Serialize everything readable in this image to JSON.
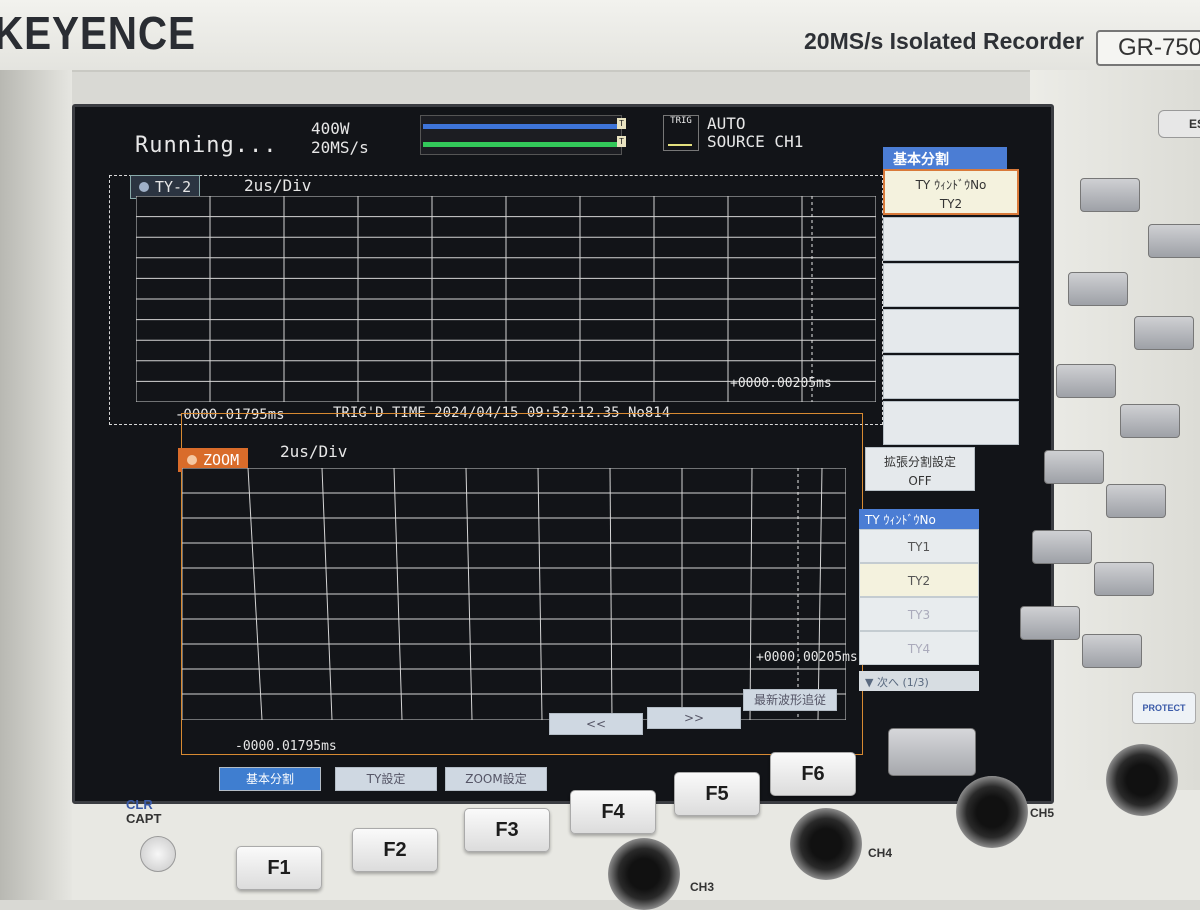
{
  "device": {
    "brand": "KEYENCE",
    "model_text": "20MS/s Isolated Recorder",
    "model_box": "GR-750"
  },
  "header": {
    "status": "Running...",
    "power": "400W",
    "rate": "20MS/s",
    "trig_icon_label": "TRIG",
    "trig_mode": "AUTO",
    "trig_source": "SOURCE CH1"
  },
  "top_pane": {
    "name": "TY-2",
    "div": "2us/Div",
    "left_time": "-0000.01795ms",
    "right_time": "+0000.00205ms",
    "trig_time": "TRIG'D TIME 2024/04/15 09:52:12.35  No814"
  },
  "zoom_pane": {
    "name": "ZOOM",
    "div": "2us/Div",
    "left_time": "-0000.01795ms",
    "right_time": "+0000.00205ms"
  },
  "side_menu": {
    "title": "基本分割",
    "selected_line1": "TY ｳｨﾝﾄﾞｳNo",
    "selected_line2": "TY2",
    "ext_line1": "拡張分割設定",
    "ext_line2": "OFF"
  },
  "sub_menu": {
    "title": "TY ｳｨﾝﾄﾞｳNo",
    "items": [
      "TY1",
      "TY2",
      "TY3",
      "TY4"
    ],
    "nav": "▼ 次へ (1/3)"
  },
  "soft_keys": {
    "f1": "基本分割",
    "f2": "TY設定",
    "f3": "ZOOM設定",
    "f4": "<<",
    "f5": ">>",
    "f6": "最新波形追従"
  },
  "keys": {
    "f1": "F1",
    "f2": "F2",
    "f3": "F3",
    "f4": "F4",
    "f5": "F5",
    "f6": "F6",
    "clr": "CLR",
    "capt": "CAPT",
    "protect": "PROTECT",
    "esc": "ES",
    "ch3": "CH3",
    "ch4": "CH4",
    "ch5": "CH5"
  }
}
